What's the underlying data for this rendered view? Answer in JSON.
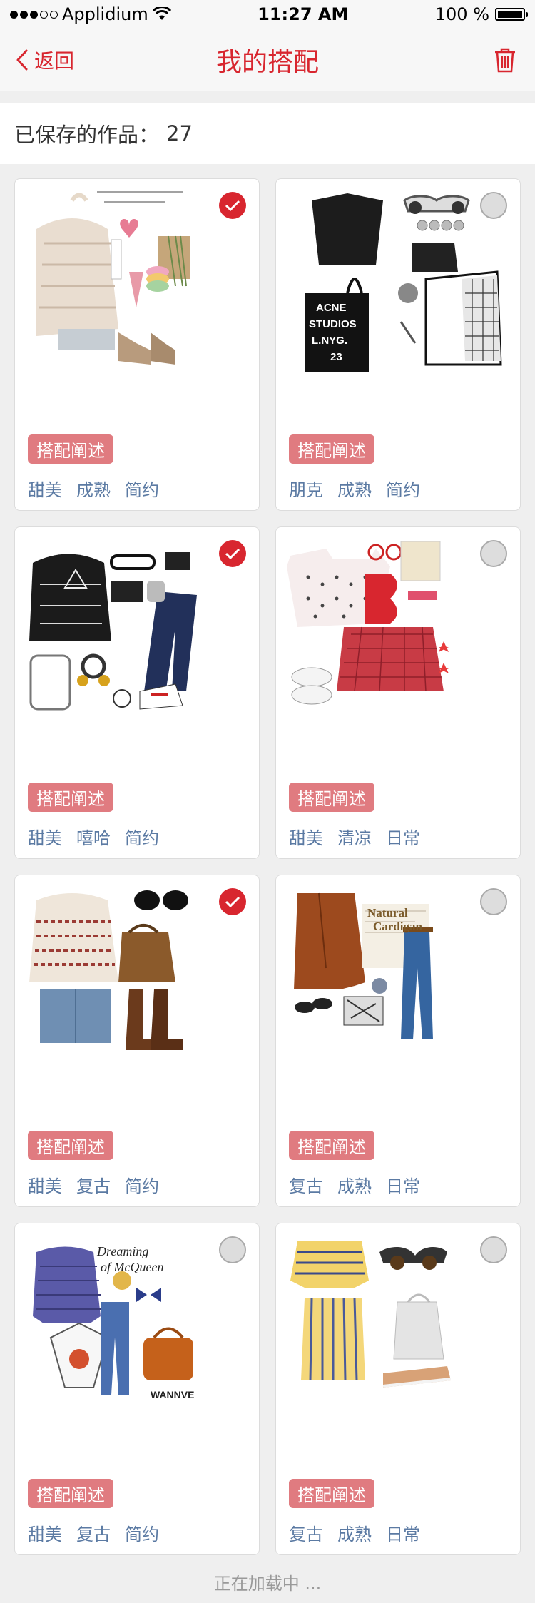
{
  "status": {
    "carrier": "Applidium",
    "time": "11:27 AM",
    "battery": "100 %"
  },
  "nav": {
    "back_label": "返回",
    "title": "我的搭配",
    "trash_icon": "trash-icon"
  },
  "summary": {
    "label": "已保存的作品：",
    "count": "27"
  },
  "cards": [
    {
      "badge": "搭配阐述",
      "tags": [
        "甜美",
        "成熟",
        "简约"
      ],
      "selected": true,
      "overlay_text": "everything will be okay in the end."
    },
    {
      "badge": "搭配阐述",
      "tags": [
        "朋克",
        "成熟",
        "简约"
      ],
      "selected": false,
      "overlay_text": "ACNE STUDIOS L.NYG. 23"
    },
    {
      "badge": "搭配阐述",
      "tags": [
        "甜美",
        "嘻哈",
        "简约"
      ],
      "selected": true
    },
    {
      "badge": "搭配阐述",
      "tags": [
        "甜美",
        "清凉",
        "日常"
      ],
      "selected": false,
      "overlay_text": "B"
    },
    {
      "badge": "搭配阐述",
      "tags": [
        "甜美",
        "复古",
        "简约"
      ],
      "selected": true
    },
    {
      "badge": "搭配阐述",
      "tags": [
        "复古",
        "成熟",
        "日常"
      ],
      "selected": false,
      "overlay_text": "Natural Cardigan"
    },
    {
      "badge": "搭配阐述",
      "tags": [
        "甜美",
        "复古",
        "简约"
      ],
      "selected": false,
      "overlay_text": "Dreaming of McQueen WANNVE"
    },
    {
      "badge": "搭配阐述",
      "tags": [
        "复古",
        "成熟",
        "日常"
      ],
      "selected": false
    }
  ],
  "loading": "正在加载中 ...",
  "colors": {
    "accent": "#d8262f",
    "badge": "#e07b80",
    "tag": "#5b7aa3"
  }
}
